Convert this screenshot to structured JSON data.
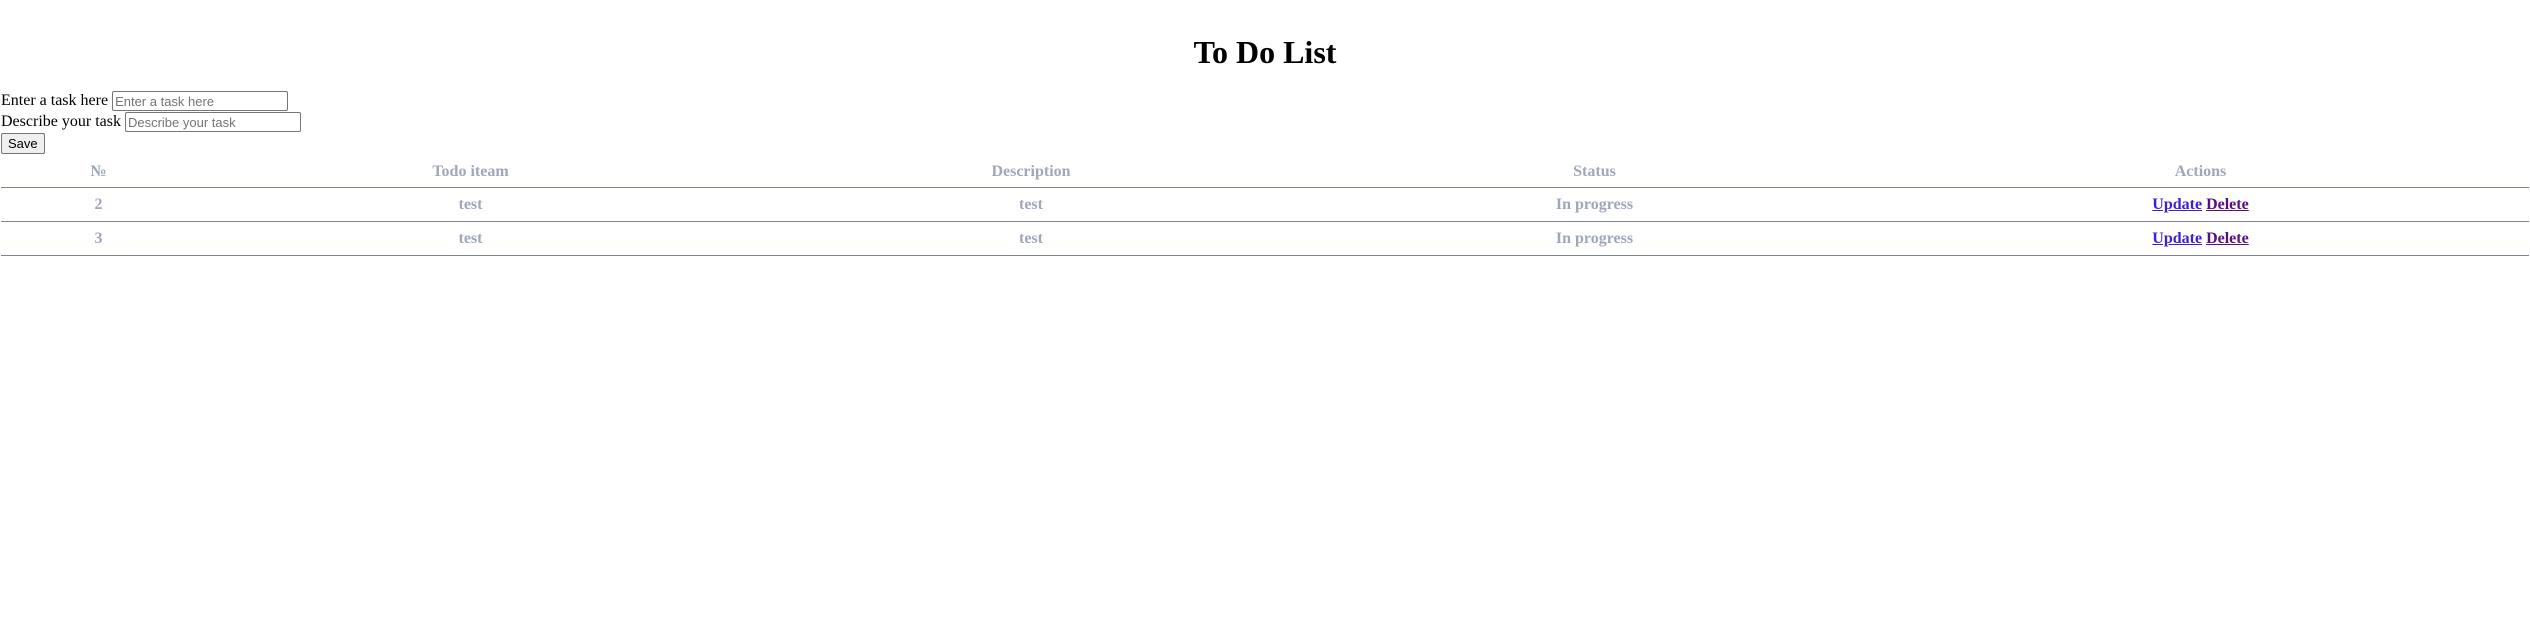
{
  "title": "To Do List",
  "form": {
    "task_label": "Enter a task here",
    "task_placeholder": "Enter a task here",
    "task_value": "",
    "desc_label": "Describe your task",
    "desc_placeholder": "Describe your task",
    "desc_value": "",
    "save_label": "Save"
  },
  "table": {
    "headers": [
      "№",
      "Todo iteam",
      "Description",
      "Status",
      "Actions"
    ],
    "rows": [
      {
        "num": "2",
        "item": "test",
        "description": "test",
        "status": "In progress",
        "update": "Update",
        "delete": "Delete"
      },
      {
        "num": "3",
        "item": "test",
        "description": "test",
        "status": "In progress",
        "update": "Update",
        "delete": "Delete"
      }
    ]
  },
  "colors": {
    "table_text": "#a0a8b8",
    "row_border": "#7f7fb0",
    "update_link": "#3c1fd6",
    "delete_link": "#5a0f7a"
  }
}
